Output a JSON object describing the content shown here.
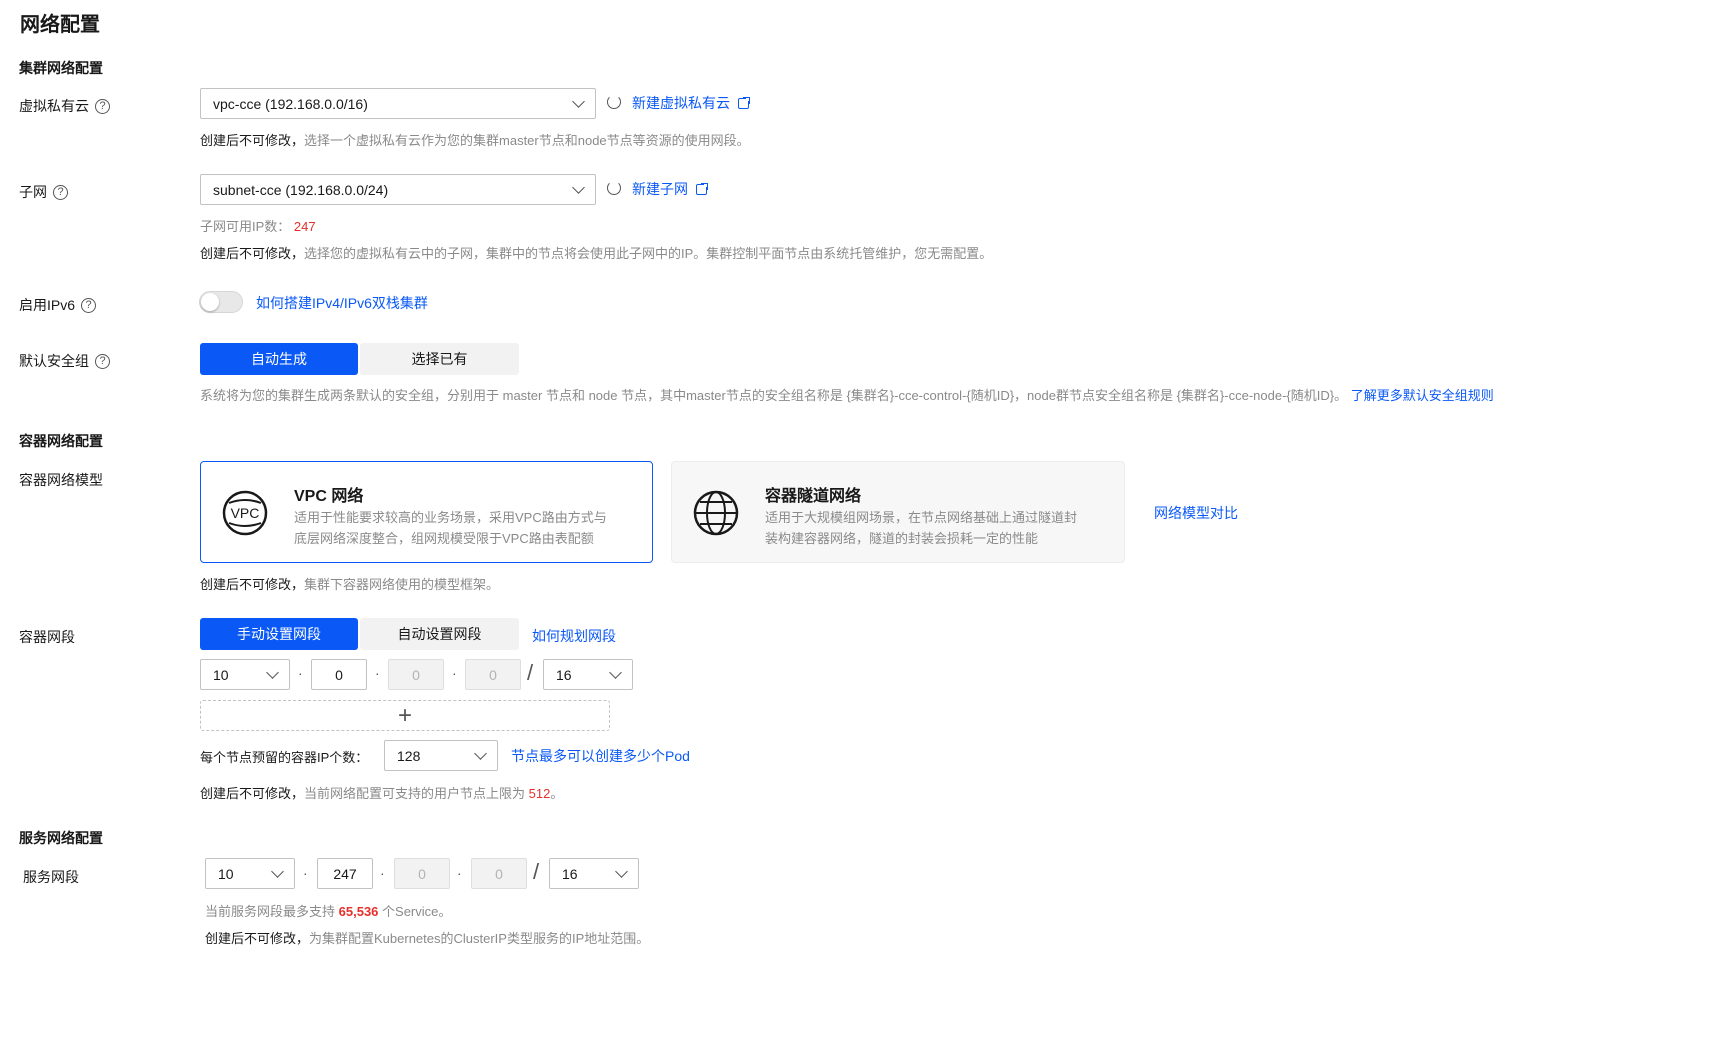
{
  "page_title": "网络配置",
  "cluster_network": {
    "section_title": "集群网络配置",
    "vpc": {
      "label": "虚拟私有云",
      "value": "vpc-cce (192.168.0.0/16)",
      "new_link": "新建虚拟私有云",
      "hint_bold": "创建后不可修改，",
      "hint": "选择一个虚拟私有云作为您的集群master节点和node节点等资源的使用网段。"
    },
    "subnet": {
      "label": "子网",
      "value": "subnet-cce (192.168.0.0/24)",
      "new_link": "新建子网",
      "available_label": "子网可用IP数：",
      "available_value": "247",
      "hint_bold": "创建后不可修改，",
      "hint": "选择您的虚拟私有云中的子网，集群中的节点将会使用此子网中的IP。集群控制平面节点由系统托管维护，您无需配置。"
    },
    "ipv6": {
      "label": "启用IPv6",
      "enabled": false,
      "link": "如何搭建IPv4/IPv6双栈集群"
    },
    "security_group": {
      "label": "默认安全组",
      "options": [
        "自动生成",
        "选择已有"
      ],
      "selected": "自动生成",
      "hint": "系统将为您的集群生成两条默认的安全组，分别用于 master 节点和 node 节点，其中master节点的安全组名称是 {集群名}-cce-control-{随机ID}，node群节点安全组名称是 {集群名}-cce-node-{随机ID}。",
      "link": "了解更多默认安全组规则"
    }
  },
  "container_network": {
    "section_title": "容器网络配置",
    "model": {
      "label": "容器网络模型",
      "cards": [
        {
          "icon_text": "VPC",
          "title": "VPC 网络",
          "desc_line1": "适用于性能要求较高的业务场景，采用VPC路由方式与",
          "desc_line2": "底层网络深度整合，组网规模受限于VPC路由表配额",
          "selected": true
        },
        {
          "icon_text": "",
          "title": "容器隧道网络",
          "desc_line1": "适用于大规模组网场景，在节点网络基础上通过隧道封",
          "desc_line2": "装构建容器网络，隧道的封装会损耗一定的性能",
          "selected": false
        }
      ],
      "compare_link": "网络模型对比",
      "hint_bold": "创建后不可修改，",
      "hint": "集群下容器网络使用的模型框架。"
    },
    "cidr": {
      "label": "容器网段",
      "options": [
        "手动设置网段",
        "自动设置网段"
      ],
      "selected": "手动设置网段",
      "plan_link": "如何规划网段",
      "octet1": "10",
      "octet2": "0",
      "octet3": "0",
      "octet4": "0",
      "mask": "16",
      "add_symbol": "+",
      "per_node_label": "每个节点预留的容器IP个数：",
      "per_node_value": "128",
      "per_node_link": "节点最多可以创建多少个Pod",
      "hint_bold": "创建后不可修改，",
      "hint": "当前网络配置可支持的用户节点上限为",
      "hint_value": "512",
      "hint_tail": "。"
    }
  },
  "service_network": {
    "section_title": "服务网络配置",
    "label": "服务网段",
    "octet1": "10",
    "octet2": "247",
    "octet3": "0",
    "octet4": "0",
    "mask": "16",
    "support_prefix": "当前服务网段最多支持",
    "support_value": "65,536",
    "support_suffix": "个Service。",
    "hint_bold": "创建后不可修改，",
    "hint": "为集群配置Kubernetes的ClusterIP类型服务的IP地址范围。"
  },
  "colors": {
    "primary": "#0a59f7",
    "danger": "#e5302c",
    "text": "#191919",
    "muted": "#8a8a8a"
  }
}
